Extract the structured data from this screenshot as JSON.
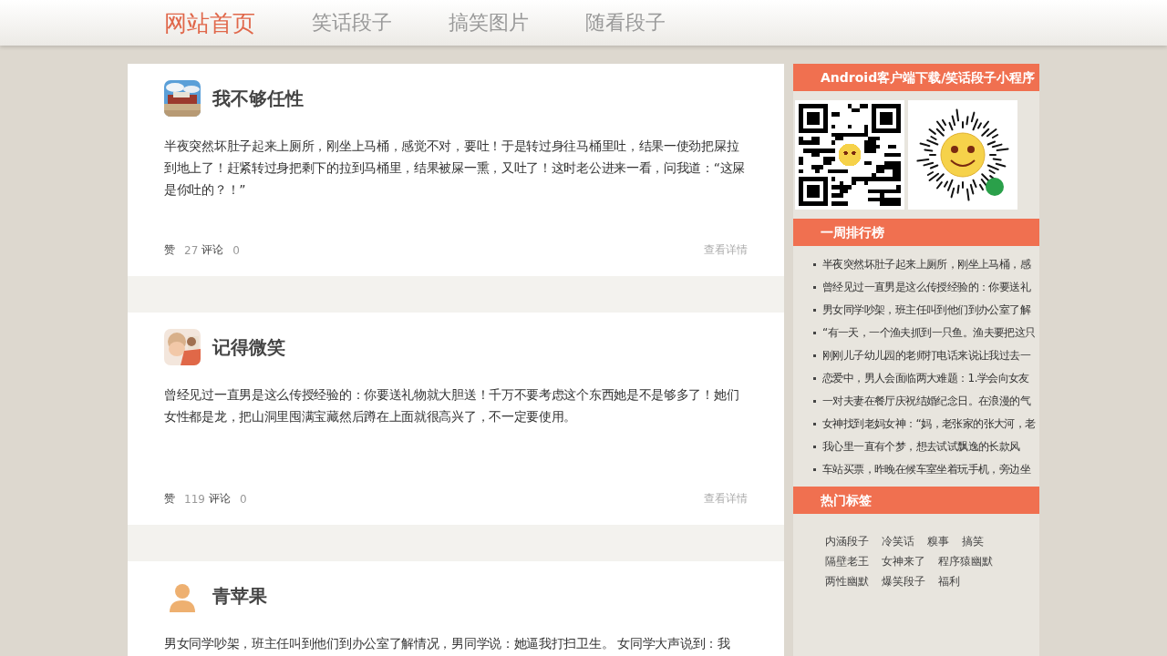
{
  "nav": {
    "items": [
      {
        "label": "网站首页",
        "selected": true
      },
      {
        "label": "笑话段子",
        "selected": false
      },
      {
        "label": "搞笑图片",
        "selected": false
      },
      {
        "label": "随看段子",
        "selected": false
      }
    ]
  },
  "posts": [
    {
      "author": "我不够任性",
      "text": "半夜突然坏肚子起来上厕所，刚坐上马桶，感觉不对，要吐！于是转过身往马桶里吐，结果一使劲把屎拉到地上了！赶紧转过身把剩下的拉到马桶里，结果被屎一熏，又吐了！这时老公进来一看，问我道：“这屎是你吐的？！”",
      "like_label": "赞",
      "likes": "27",
      "comment_label": "评论",
      "comments": "0",
      "detail_link": "查看详情"
    },
    {
      "author": "记得微笑",
      "text": "曾经见过一直男是这么传授经验的：你要送礼物就大胆送！千万不要考虑这个东西她是不是够多了！她们女性都是龙，把山洞里囤满宝藏然后蹲在上面就很高兴了，不一定要使用。",
      "like_label": "赞",
      "likes": "119",
      "comment_label": "评论",
      "comments": "0",
      "detail_link": "查看详情"
    },
    {
      "author": "青苹果",
      "avatar": {
        "kind": "default"
      },
      "text": "男女同学吵架，班主任叫到他们到办公室了解情况，男同学说：她逼我打扫卫生。 女同学大声说到：我"
    }
  ],
  "sidebar": {
    "download": {
      "title": "Android客户端下载/笑话段子小程序"
    },
    "ranking": {
      "title": "一周排行榜",
      "items": [
        "半夜突然坏肚子起来上厕所，刚坐上马桶，感",
        "曾经见过一直男是这么传授经验的：你要送礼",
        "男女同学吵架，班主任叫到他们到办公室了解",
        "“有一天，一个渔夫抓到一只鱼。渔夫要把这只",
        "刚刚儿子幼儿园的老师打电话来说让我过去一",
        "恋爱中，男人会面临两大难题：1.学会向女友",
        "一对夫妻在餐厅庆祝结婚纪念日。在浪漫的气",
        "女神找到老妈女神：“妈，老张家的张大河，老",
        "我心里一直有个梦，想去试试飘逸的长款风",
        "车站买票，昨晚在候车室坐着玩手机，旁边坐"
      ]
    },
    "tags": {
      "title": "热门标签",
      "rows": [
        [
          "内涵段子",
          "冷笑话",
          "糗事",
          "搞笑"
        ],
        [
          "隔壁老王",
          "女神来了",
          "程序猿幽默"
        ],
        [
          "两性幽默",
          "爆笑段子",
          "福利"
        ]
      ]
    }
  }
}
